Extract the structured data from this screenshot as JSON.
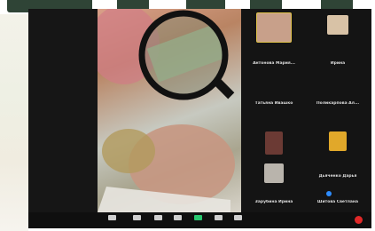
{
  "app": {
    "accent_color": "#2d8cff",
    "share_color": "#28c76f",
    "leave_color": "#e02828"
  },
  "participants": [
    {
      "name": "",
      "subtitle": "",
      "thumb_color": "#c8a08a"
    },
    {
      "name": "",
      "subtitle": "",
      "thumb_color": "#d8c2a6"
    },
    {
      "name": "Антонова Мария...",
      "subtitle": ""
    },
    {
      "name": "Ирина",
      "subtitle": ""
    },
    {
      "name": "Татьяна Ивашко",
      "subtitle": ""
    },
    {
      "name": "Поликарпова Ал...",
      "subtitle": ""
    },
    {
      "name": "",
      "subtitle": "",
      "thumb_color": "#6b3a34"
    },
    {
      "name": "",
      "subtitle": "",
      "thumb_color": "#e1a82a"
    },
    {
      "name": "",
      "subtitle": "",
      "thumb_color": "#b9b4ac"
    },
    {
      "name": "Дьяченко Дарья",
      "subtitle": ""
    },
    {
      "name": "Зарубина Ирина",
      "subtitle": ""
    },
    {
      "name": "Шитова Светлана",
      "subtitle": ""
    }
  ],
  "toolbar": {
    "buttons": [
      {
        "label": "",
        "icon": "microphone-icon"
      },
      {
        "label": "",
        "icon": "video-camera-icon"
      },
      {
        "label": "",
        "icon": "participants-icon"
      },
      {
        "label": "",
        "icon": "chat-icon"
      },
      {
        "label": "",
        "icon": "share-screen-icon"
      },
      {
        "label": "",
        "icon": "record-icon"
      },
      {
        "label": "",
        "icon": "reactions-icon"
      }
    ],
    "leave_icon": "leave-icon"
  }
}
